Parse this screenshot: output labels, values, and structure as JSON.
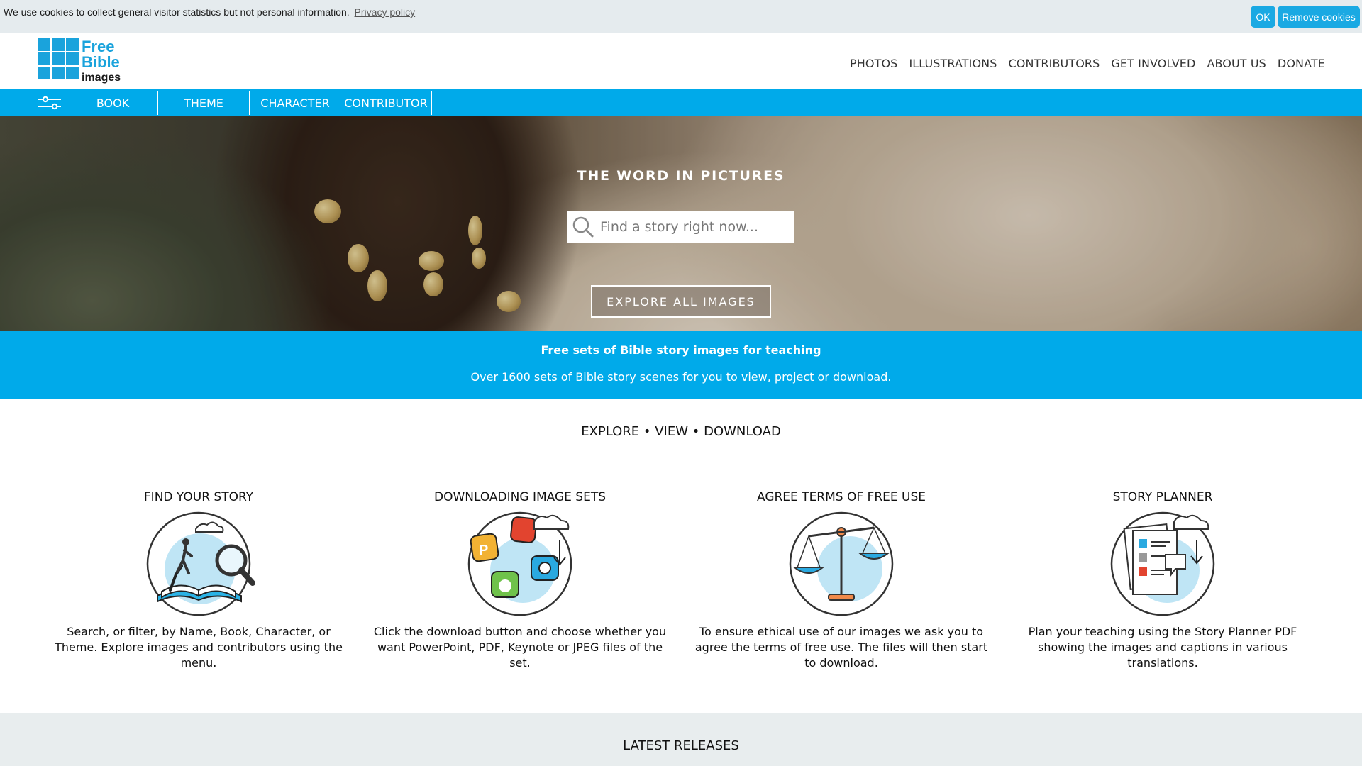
{
  "cookie": {
    "message": "We use cookies to collect general visitor statistics but not personal information.",
    "privacy_link": "Privacy policy",
    "ok_label": "OK",
    "remove_label": "Remove cookies"
  },
  "header": {
    "logo_alt_lines": [
      "Free",
      "Bible",
      "images"
    ],
    "nav": [
      "PHOTOS",
      "ILLUSTRATIONS",
      "CONTRIBUTORS",
      "GET INVOLVED",
      "ABOUT US",
      "DONATE"
    ]
  },
  "filter_bar": {
    "icon": "sliders-icon",
    "items": [
      "BOOK",
      "THEME",
      "CHARACTER",
      "CONTRIBUTOR"
    ]
  },
  "hero": {
    "title": "THE WORD IN PICTURES",
    "search_placeholder": "Find a story right now...",
    "explore_label": "EXPLORE ALL IMAGES"
  },
  "info_strip": {
    "title": "Free sets of Bible story images for teaching",
    "subtitle": "Over 1600 sets of Bible story scenes for you to view, project or download."
  },
  "tagline": "EXPLORE • VIEW • DOWNLOAD",
  "features": [
    {
      "title": "FIND YOUR STORY",
      "icon": "book-search-icon",
      "desc": "Search, or filter, by Name, Book, Character, or Theme. Explore images and contributors using the menu."
    },
    {
      "title": "DOWNLOADING IMAGE SETS",
      "icon": "download-formats-icon",
      "desc": "Click the download button and choose whether you want PowerPoint, PDF, Keynote or JPEG files of the set."
    },
    {
      "title": "AGREE TERMS OF FREE USE",
      "icon": "scales-icon",
      "desc": "To ensure ethical use of our images we ask you to agree the terms of free use. The files will then start to download."
    },
    {
      "title": "STORY PLANNER",
      "icon": "story-planner-icon",
      "desc": "Plan your teaching using the Story Planner PDF showing the images and captions in various translations."
    }
  ],
  "releases": {
    "title": "LATEST RELEASES"
  },
  "colors": {
    "brand_blue": "#00aaea",
    "button_blue": "#1aa9e3",
    "light_gray": "#e8edee"
  }
}
